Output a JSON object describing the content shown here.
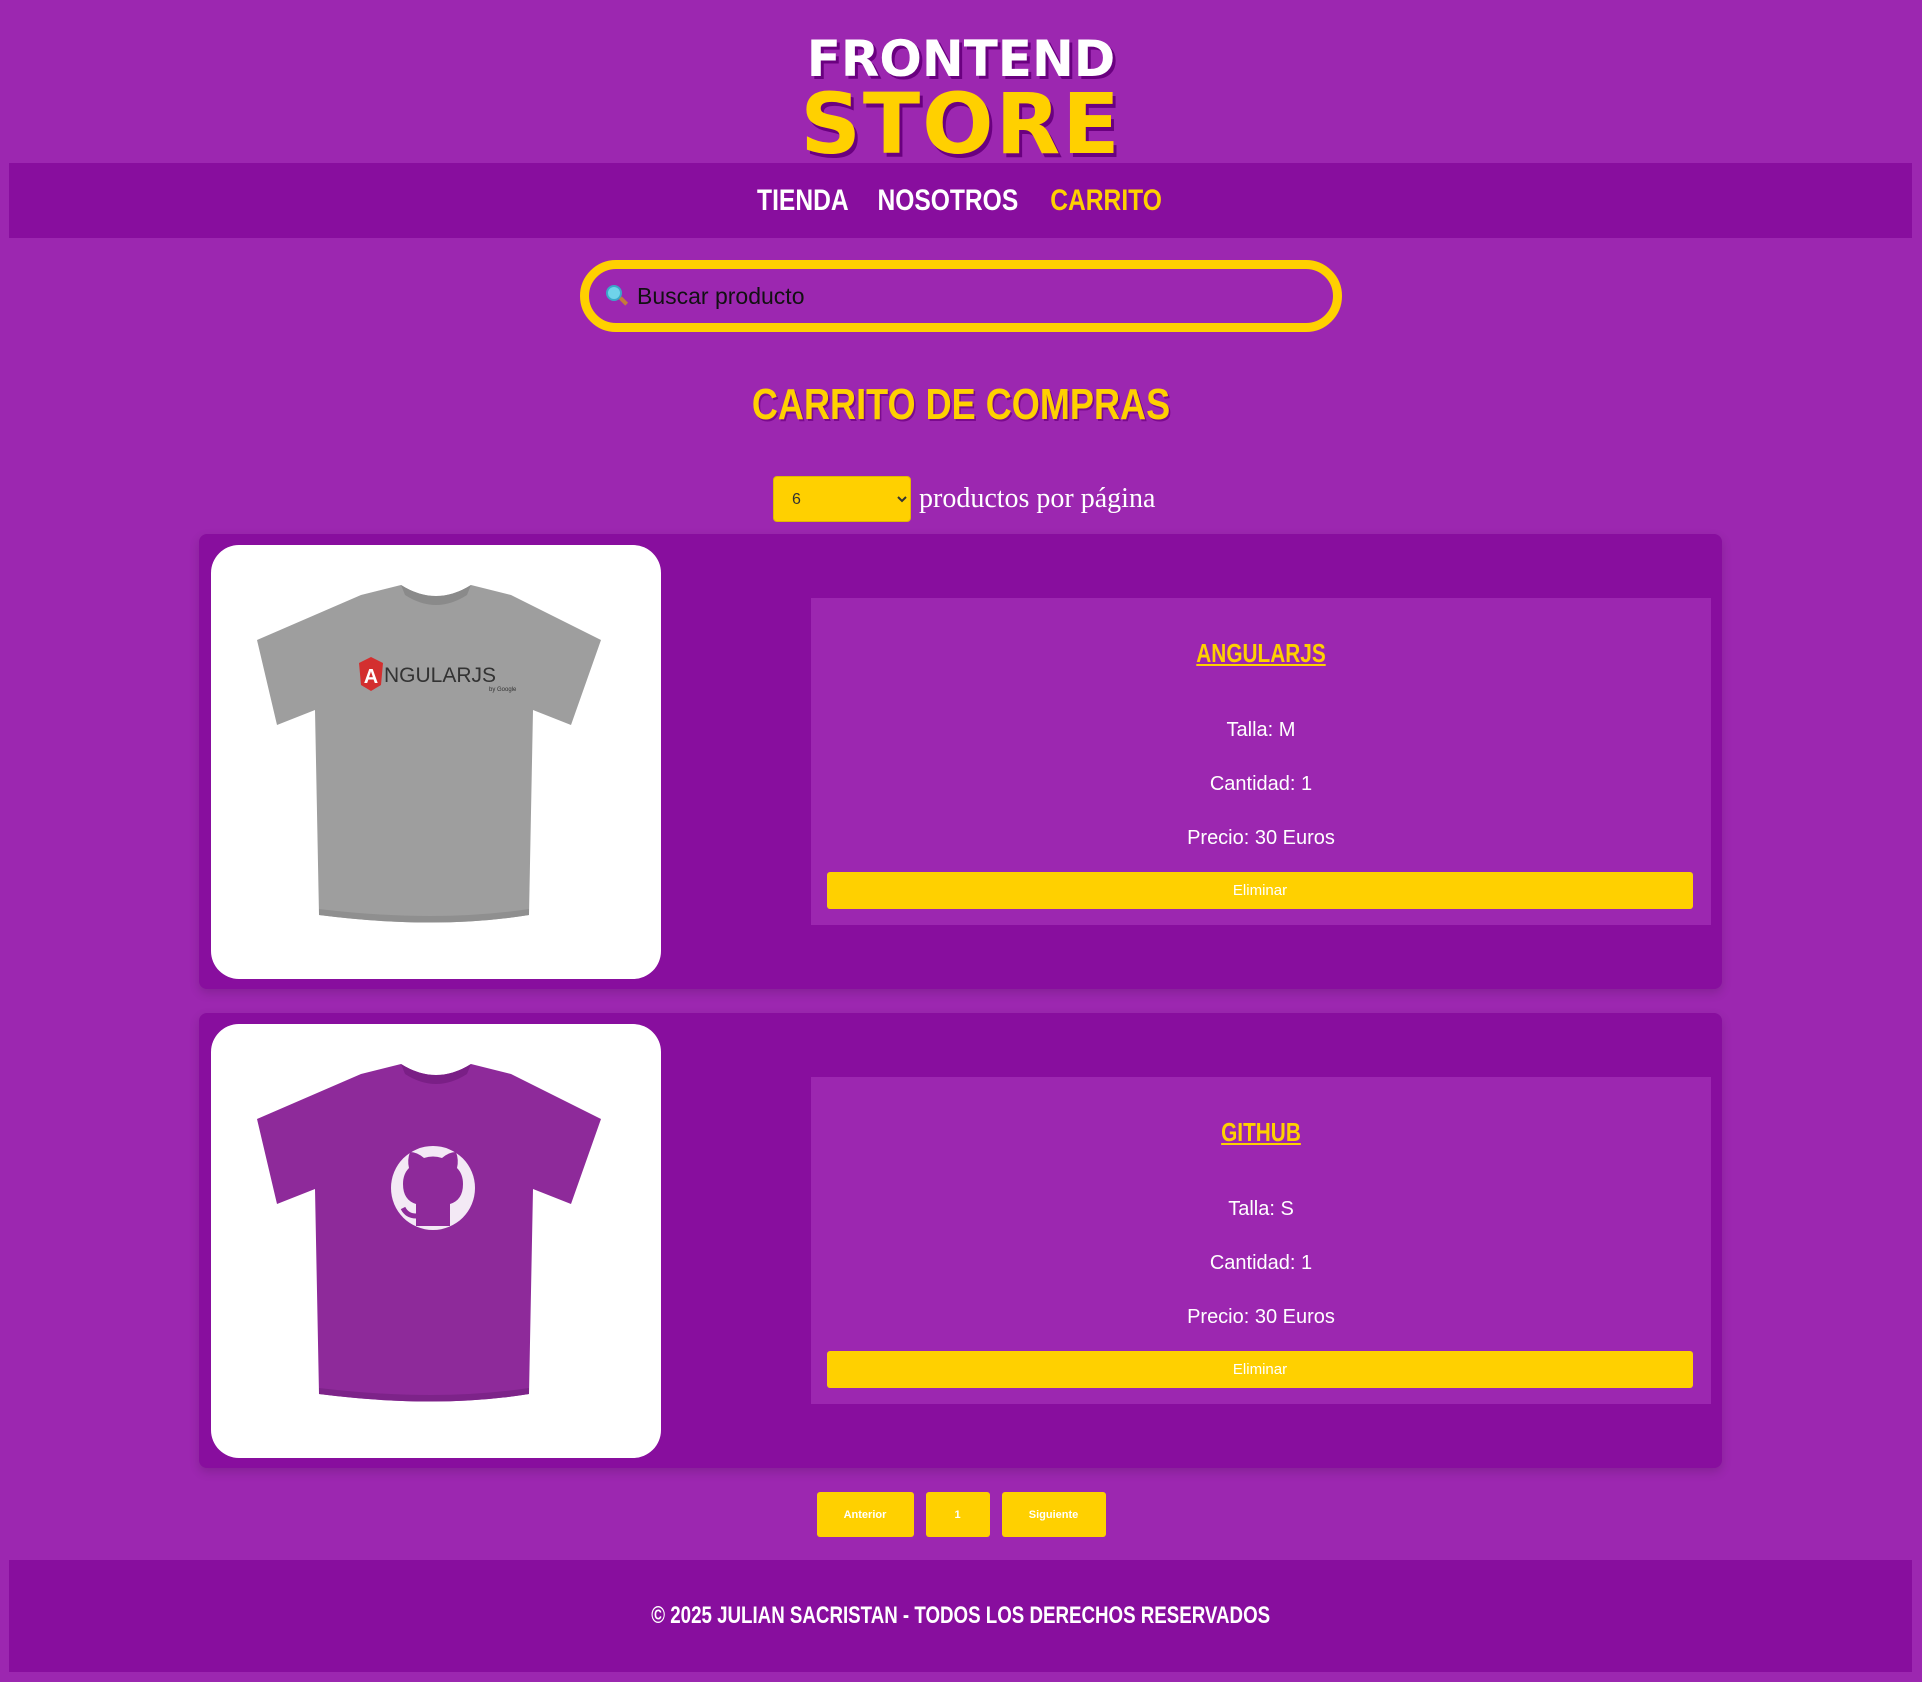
{
  "logo": {
    "line1": "FRONTEND",
    "line2": "STORE"
  },
  "nav": {
    "items": [
      {
        "label": "TIENDA"
      },
      {
        "label": "NOSOTROS"
      },
      {
        "label": "CARRITO"
      }
    ],
    "active": "CARRITO"
  },
  "search": {
    "placeholder": "Buscar producto",
    "icon": "search-icon"
  },
  "page": {
    "title": "CARRITO DE COMPRAS"
  },
  "per_page": {
    "selected": "6",
    "label": "productos por página"
  },
  "cart": {
    "items": [
      {
        "name": "ANGULARJS",
        "size": "Talla: M",
        "quantity": "Cantidad: 1",
        "price": "Precio: 30 Euros",
        "remove_label": "Eliminar",
        "shirt_color": "#9e9e9e",
        "logo_text": "NGULARJS",
        "logo_letter": "A",
        "logo_sub": "by Google"
      },
      {
        "name": "GITHUB",
        "size": "Talla: S",
        "quantity": "Cantidad: 1",
        "price": "Precio: 30 Euros",
        "remove_label": "Eliminar",
        "shirt_color": "#8e2a9a"
      }
    ]
  },
  "pagination": {
    "prev": "Anterior",
    "page": "1",
    "next": "Siguiente"
  },
  "footer": {
    "text": "© 2025 JULIAN SACRISTAN - TODOS LOS DERECHOS RESERVADOS"
  },
  "colors": {
    "background": "#9c27b0",
    "panel": "#880e9e",
    "accent": "#ffd000"
  }
}
